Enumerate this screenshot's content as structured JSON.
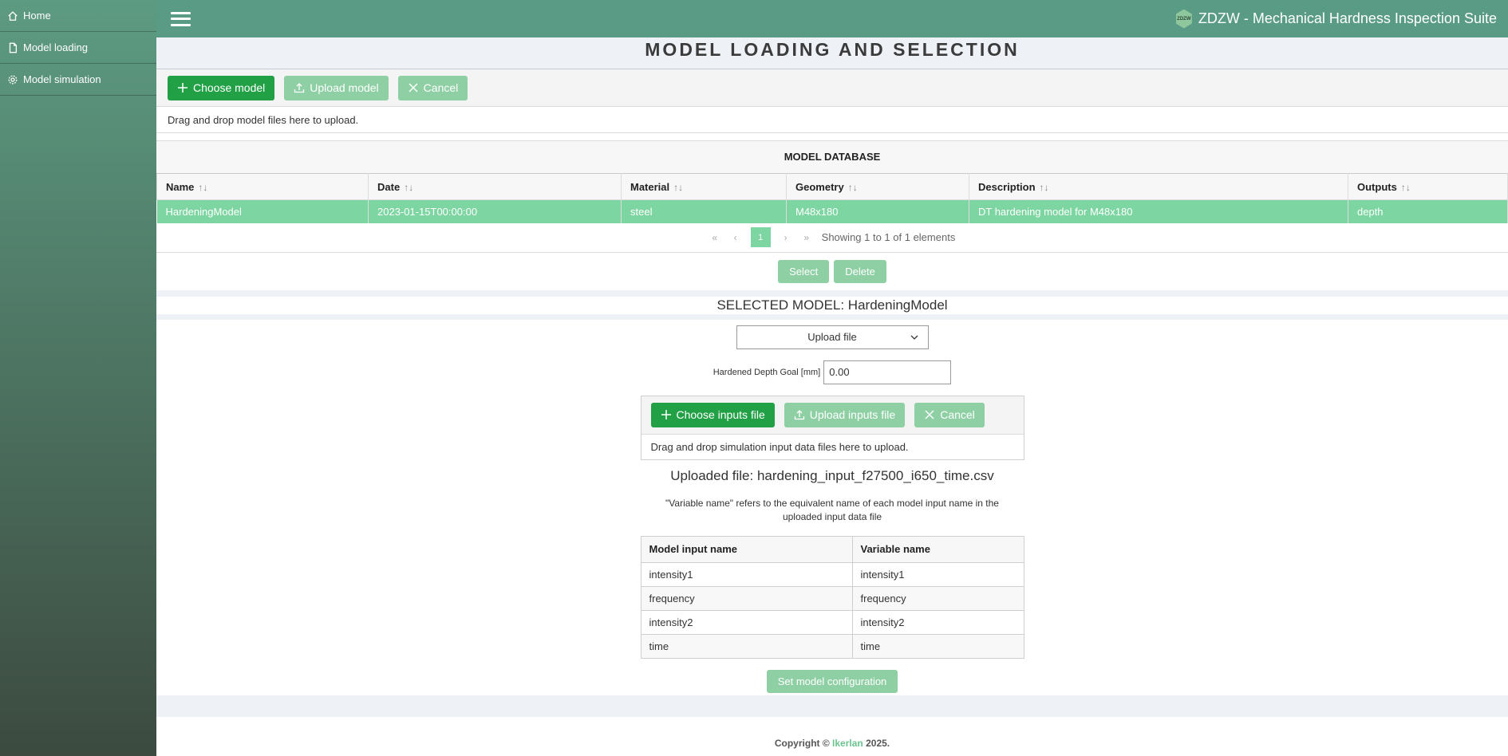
{
  "sidebar": {
    "items": [
      {
        "label": "Home",
        "icon": "home-icon"
      },
      {
        "label": "Model loading",
        "icon": "file-icon"
      },
      {
        "label": "Model simulation",
        "icon": "gear-icon"
      }
    ]
  },
  "topbar": {
    "title": "ZDZW - Mechanical Hardness Inspection Suite",
    "logo_text": "ZDZW"
  },
  "page": {
    "title": "MODEL LOADING AND SELECTION"
  },
  "model_upload": {
    "choose_label": "Choose model",
    "upload_label": "Upload model",
    "cancel_label": "Cancel",
    "drop_text": "Drag and drop model files here to upload."
  },
  "model_database": {
    "title": "MODEL DATABASE",
    "columns": [
      "Name",
      "Date",
      "Material",
      "Geometry",
      "Description",
      "Outputs"
    ],
    "rows": [
      [
        "HardeningModel",
        "2023-01-15T00:00:00",
        "steel",
        "M48x180",
        "DT hardening model for M48x180",
        "depth"
      ]
    ],
    "paginator": {
      "first": "«",
      "prev": "‹",
      "current_page": "1",
      "next": "›",
      "last": "»",
      "summary": "Showing 1 to 1 of 1 elements"
    },
    "select_label": "Select",
    "delete_label": "Delete"
  },
  "selected_model": {
    "title": "SELECTED MODEL: HardeningModel",
    "source_dropdown": "Upload file",
    "goal_label": "Hardened Depth Goal [mm]",
    "goal_value": "0.00"
  },
  "inputs_upload": {
    "choose_label": "Choose inputs file",
    "upload_label": "Upload inputs file",
    "cancel_label": "Cancel",
    "drop_text": "Drag and drop simulation input data files here to upload.",
    "uploaded_file": "Uploaded file: hardening_input_f27500_i650_time.csv",
    "note": "\"Variable name\" refers to the equivalent name of each model input name in the uploaded input data file"
  },
  "mapping": {
    "columns": [
      "Model input name",
      "Variable name"
    ],
    "rows": [
      [
        "intensity1",
        "intensity1"
      ],
      [
        "frequency",
        "frequency"
      ],
      [
        "intensity2",
        "intensity2"
      ],
      [
        "time",
        "time"
      ]
    ],
    "set_config_label": "Set model configuration"
  },
  "footer": {
    "prefix": "Copyright ©",
    "brand": "Ikerlan",
    "suffix": "2025.",
    "brand_color": "#6cc48f"
  },
  "colors": {
    "topbar": "#5a9b86",
    "primary_button": "#22a046",
    "light_button": "#8ed0a4",
    "selected_row": "#7dd5a1"
  }
}
